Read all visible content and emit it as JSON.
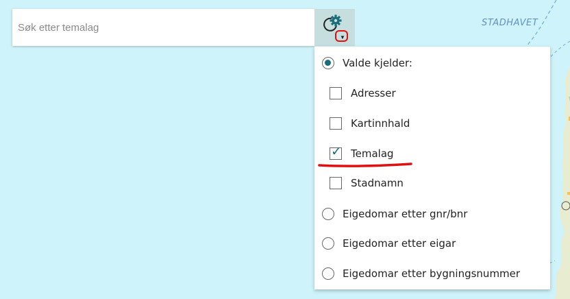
{
  "map": {
    "sea_label": "STADHAVET"
  },
  "search": {
    "placeholder": "Søk etter temalag"
  },
  "source_menu": {
    "items": [
      {
        "type": "radio",
        "label": "Valde kjelder:",
        "checked": true
      },
      {
        "type": "checkbox",
        "label": "Adresser",
        "checked": false
      },
      {
        "type": "checkbox",
        "label": "Kartinnhald",
        "checked": false
      },
      {
        "type": "checkbox",
        "label": "Temalag",
        "checked": true
      },
      {
        "type": "checkbox",
        "label": "Stadnamn",
        "checked": false
      },
      {
        "type": "radio",
        "label": "Eigedomar etter gnr/bnr",
        "checked": false
      },
      {
        "type": "radio",
        "label": "Eigedomar etter eigar",
        "checked": false
      },
      {
        "type": "radio",
        "label": "Eigedomar etter bygningsnummer",
        "checked": false
      }
    ]
  },
  "colors": {
    "accent": "#1a6d7a",
    "annotation": "#e01010",
    "sea": "#cff3fa"
  }
}
